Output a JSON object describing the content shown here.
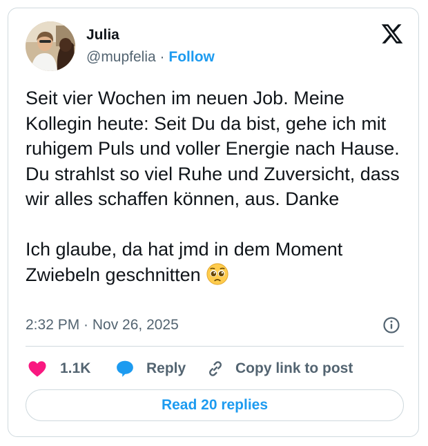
{
  "author": {
    "name": "Julia",
    "handle": "@mupfelia",
    "separator": "·",
    "follow_label": "Follow"
  },
  "tweet": {
    "text": "Seit vier Wochen im neuen Job. Meine Kollegin heute: Seit Du da bist, gehe ich mit ruhigem Puls und voller Energie nach Hause. Du strahlst so viel Ruhe und Zuversicht, dass wir alles schaffen können, aus. Danke\n\nIch glaube, da hat jmd in dem Moment Zwiebeln geschnitten ",
    "emoji_icon": "pleading-face-emoji",
    "timestamp": "2:32 PM · Nov 26, 2025"
  },
  "actions": {
    "like_count": "1.1K",
    "reply_label": "Reply",
    "copy_link_label": "Copy link to post",
    "read_replies_label": "Read 20 replies"
  },
  "colors": {
    "accent": "#1d9bf0",
    "like": "#f91880",
    "muted": "#536471",
    "border": "#cfd9de"
  }
}
